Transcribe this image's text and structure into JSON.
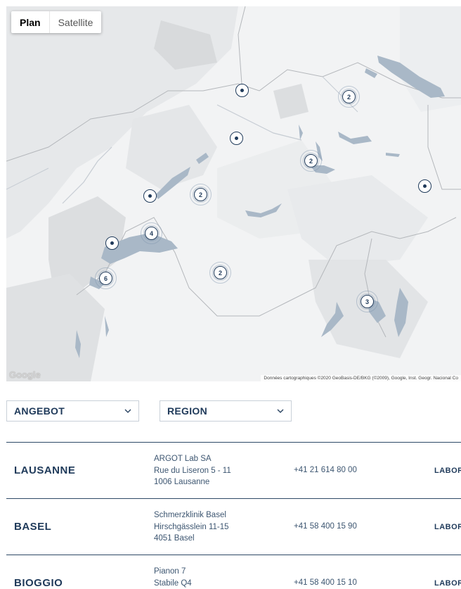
{
  "map": {
    "type_controls": [
      {
        "label": "Plan",
        "active": true
      },
      {
        "label": "Satellite",
        "active": false
      }
    ],
    "attribution": "Données cartographiques ©2020 GeoBasis-DE/BKG (©2009), Google, Inst. Geogr. Nacional   Co",
    "logo_text": "Google",
    "markers": [
      {
        "label": "",
        "kind": "single"
      },
      {
        "label": "2",
        "kind": "cluster"
      },
      {
        "label": "",
        "kind": "single"
      },
      {
        "label": "2",
        "kind": "cluster"
      },
      {
        "label": "",
        "kind": "single"
      },
      {
        "label": "",
        "kind": "single"
      },
      {
        "label": "2",
        "kind": "cluster"
      },
      {
        "label": "4",
        "kind": "cluster"
      },
      {
        "label": "",
        "kind": "single"
      },
      {
        "label": "6",
        "kind": "cluster"
      },
      {
        "label": "2",
        "kind": "cluster"
      },
      {
        "label": "3",
        "kind": "cluster"
      }
    ]
  },
  "filters": {
    "angebot": "ANGEBOT",
    "region": "REGION"
  },
  "locations": [
    {
      "city": "LAUSANNE",
      "address": [
        "ARGOT Lab SA",
        "Rue du Liseron 5 - 11",
        "1006 Lausanne"
      ],
      "phone": "+41 21 614 80 00",
      "tag": "LABORS"
    },
    {
      "city": "BASEL",
      "address": [
        "Schmerzklinik Basel",
        "Hirschgässlein 11-15",
        "4051 Basel"
      ],
      "phone": "+41 58 400 15 90",
      "tag": "LABORS"
    },
    {
      "city": "BIOGGIO",
      "address": [
        "Pianon 7",
        "Stabile Q4",
        ""
      ],
      "phone": "+41 58 400 15 10",
      "tag": "LABORS"
    }
  ],
  "colors": {
    "accent": "#1f3a5a",
    "water": "#a9b8c7",
    "land": "#f2f3f4",
    "region": "#dcdee0"
  }
}
